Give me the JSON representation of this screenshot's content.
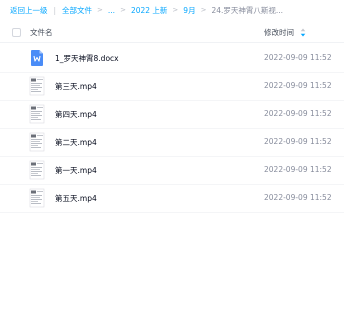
{
  "breadcrumb": {
    "back": "返回上一级",
    "items": [
      "全部文件",
      "...",
      "2022 上新",
      "9月"
    ],
    "current": "24.罗天神霄八斯视..."
  },
  "header": {
    "name_label": "文件名",
    "time_label": "修改时间"
  },
  "files": [
    {
      "name": "1_罗天神霄8.docx",
      "time": "2022-09-09 11:52",
      "icon": "word-doc-icon"
    },
    {
      "name": "第三天.mp4",
      "time": "2022-09-09 11:52",
      "icon": "video-thumbnail-icon"
    },
    {
      "name": "第四天.mp4",
      "time": "2022-09-09 11:52",
      "icon": "video-thumbnail-icon"
    },
    {
      "name": "第二天.mp4",
      "time": "2022-09-09 11:52",
      "icon": "video-thumbnail-icon"
    },
    {
      "name": "第一天.mp4",
      "time": "2022-09-09 11:52",
      "icon": "video-thumbnail-icon"
    },
    {
      "name": "第五天.mp4",
      "time": "2022-09-09 11:52",
      "icon": "video-thumbnail-icon"
    }
  ],
  "colors": {
    "link": "#06a7ff",
    "doc": "#4a8cf7"
  }
}
